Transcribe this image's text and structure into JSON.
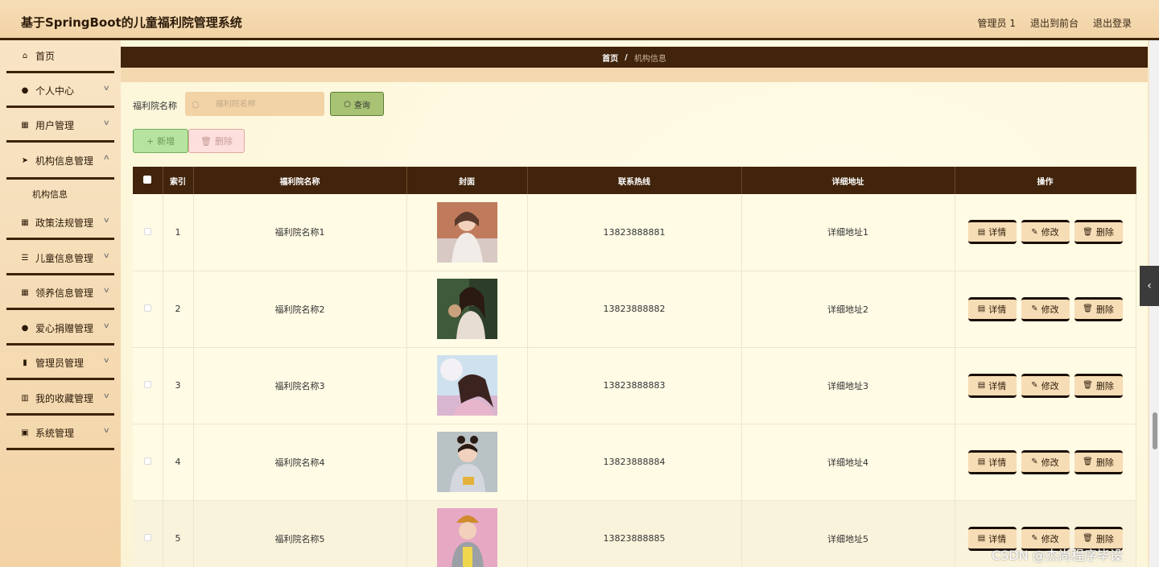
{
  "header": {
    "title": "基于SpringBoot的儿童福利院管理系统",
    "links": [
      "管理员 1",
      "退出到前台",
      "退出登录"
    ]
  },
  "sidebar": {
    "items": [
      {
        "label": "首页",
        "icon": "home-icon"
      },
      {
        "label": "个人中心",
        "icon": "user-icon"
      },
      {
        "label": "用户管理",
        "icon": "grid-icon"
      },
      {
        "label": "机构信息管理",
        "icon": "send-icon"
      },
      {
        "label": "政策法规管理",
        "icon": "grid-icon"
      },
      {
        "label": "儿童信息管理",
        "icon": "list-icon"
      },
      {
        "label": "领养信息管理",
        "icon": "grid-icon"
      },
      {
        "label": "爱心捐赠管理",
        "icon": "user-icon"
      },
      {
        "label": "管理员管理",
        "icon": "chart-icon"
      },
      {
        "label": "我的收藏管理",
        "icon": "bar-chart-icon"
      },
      {
        "label": "系统管理",
        "icon": "clipboard-icon"
      }
    ],
    "submenu": "机构信息"
  },
  "breadcrumb": {
    "home": "首页",
    "separator": "/",
    "current": "机构信息"
  },
  "search": {
    "label": "福利院名称",
    "placeholder": "福利院名称",
    "value": "",
    "query_label": "查询"
  },
  "actions": {
    "add_label": "新增",
    "delete_label": "删除"
  },
  "table": {
    "columns": [
      "索引",
      "福利院名称",
      "封面",
      "联系热线",
      "详细地址",
      "操作"
    ],
    "rows": [
      {
        "index": "1",
        "name": "福利院名称1",
        "phone": "13823888881",
        "address": "详细地址1"
      },
      {
        "index": "2",
        "name": "福利院名称2",
        "phone": "13823888882",
        "address": "详细地址2"
      },
      {
        "index": "3",
        "name": "福利院名称3",
        "phone": "13823888883",
        "address": "详细地址3"
      },
      {
        "index": "4",
        "name": "福利院名称4",
        "phone": "13823888884",
        "address": "详细地址4"
      },
      {
        "index": "5",
        "name": "福利院名称5",
        "phone": "13823888885",
        "address": "详细地址5"
      }
    ],
    "row_actions": {
      "detail": "详情",
      "edit": "修改",
      "delete": "删除"
    }
  },
  "watermark": "CSDN @杰尚程序毕设",
  "colors": {
    "accent_dark": "#41240b",
    "sidebar_bg": "#f3d3a5",
    "main_bg": "#fdf8dd",
    "query_green": "#a7c373"
  }
}
